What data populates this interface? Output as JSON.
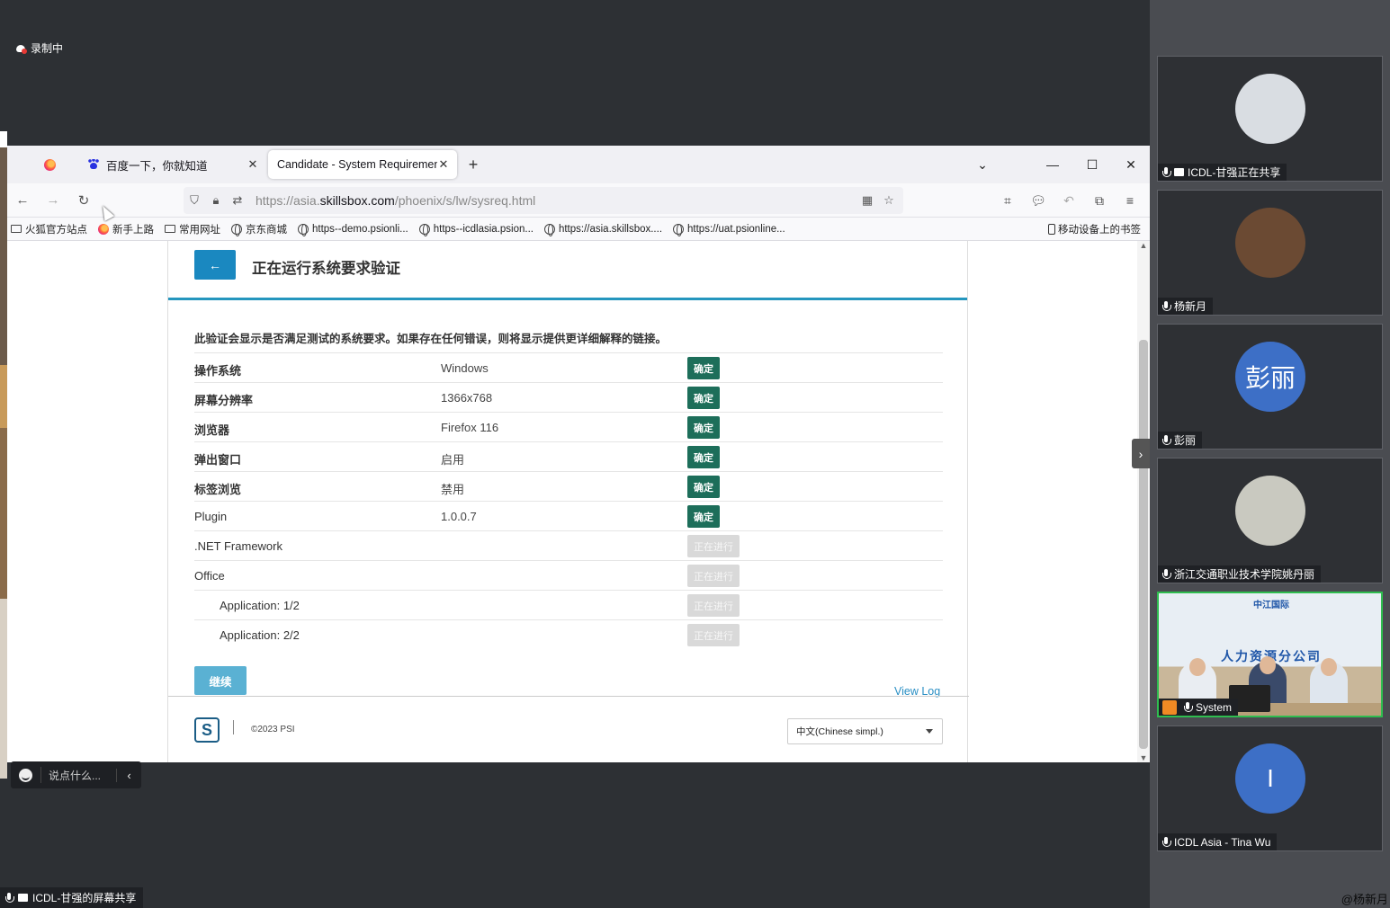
{
  "meeting": {
    "recording_label": "录制中",
    "share_label": "ICDL-甘强的屏幕共享",
    "watermark": "@杨新月",
    "chat_placeholder": "说点什么..."
  },
  "browser": {
    "tabs": [
      {
        "title": "百度一下，你就知道",
        "active": false
      },
      {
        "title": "Candidate - System Requirement",
        "active": true
      }
    ],
    "url_prefix": "https://asia.",
    "url_domain": "skillsbox.com",
    "url_suffix": "/phoenix/s/lw/sysreq.html",
    "bookmarks": [
      {
        "label": "火狐官方站点",
        "icon": "folder-icon"
      },
      {
        "label": "新手上路",
        "icon": "firefox-icon"
      },
      {
        "label": "常用网址",
        "icon": "folder-icon"
      },
      {
        "label": "京东商城",
        "icon": "globe-icon"
      },
      {
        "label": "https--demo.psionli...",
        "icon": "globe-icon"
      },
      {
        "label": "https--icdlasia.psion...",
        "icon": "globe-icon"
      },
      {
        "label": "https://asia.skillsbox....",
        "icon": "globe-icon"
      },
      {
        "label": "https://uat.psionline...",
        "icon": "globe-icon"
      }
    ],
    "mobile_bookmarks": "移动设备上的书签"
  },
  "page": {
    "title": "正在运行系统要求验证",
    "intro": "此验证会显示是否满足测试的系统要求。如果存在任何错误，则将显示提供更详细解释的链接。",
    "requirements": [
      {
        "name": "操作系统",
        "value": "Windows",
        "status": "确定",
        "state": "ok"
      },
      {
        "name": "屏幕分辨率",
        "value": "1366x768",
        "status": "确定",
        "state": "ok"
      },
      {
        "name": "浏览器",
        "value": "Firefox 116",
        "status": "确定",
        "state": "ok"
      },
      {
        "name": "弹出窗口",
        "value": "启用",
        "status": "确定",
        "state": "ok"
      },
      {
        "name": "标签浏览",
        "value": "禁用",
        "status": "确定",
        "state": "ok"
      },
      {
        "name": "Plugin",
        "value": "1.0.0.7",
        "status": "确定",
        "state": "ok"
      },
      {
        "name": ".NET Framework",
        "value": "",
        "status": "正在进行",
        "state": "pending"
      },
      {
        "name": "Office",
        "value": "",
        "status": "正在进行",
        "state": "pending"
      },
      {
        "name": "Application: 1/2",
        "value": "",
        "status": "正在进行",
        "state": "pending",
        "indent": true
      },
      {
        "name": "Application: 2/2",
        "value": "",
        "status": "正在进行",
        "state": "pending",
        "indent": true
      }
    ],
    "continue_label": "继续",
    "view_log": "View Log",
    "logo_letter": "S",
    "copyright": "©2023 PSI",
    "language": "中文(Chinese simpl.)"
  },
  "participants": [
    {
      "name": "ICDL-甘强正在共享",
      "avatar_text": "",
      "avatar_color": "#d9dde2",
      "sharing": true
    },
    {
      "name": "杨新月",
      "avatar_text": "",
      "avatar_color": "#6b4a33",
      "sharing": false
    },
    {
      "name": "彭丽",
      "avatar_text": "彭丽",
      "avatar_color": "#3d6fc6",
      "sharing": false
    },
    {
      "name": "浙江交通职业技术学院姚丹丽",
      "avatar_text": "",
      "avatar_color": "#c9c9c0",
      "sharing": false
    },
    {
      "name": "System",
      "avatar_text": "",
      "avatar_color": "",
      "sharing": false,
      "video": true
    },
    {
      "name": "ICDL Asia - Tina Wu",
      "avatar_text": "I",
      "avatar_color": "#3d6fc6",
      "sharing": false
    }
  ],
  "video_room": {
    "logo_text": "中江国际",
    "banner_text": "人力资源分公司"
  },
  "colors": {
    "ok": "#1d6e5a",
    "pending": "#d9d9d9",
    "accent": "#2596be",
    "active_speaker": "#2fbd4f"
  }
}
